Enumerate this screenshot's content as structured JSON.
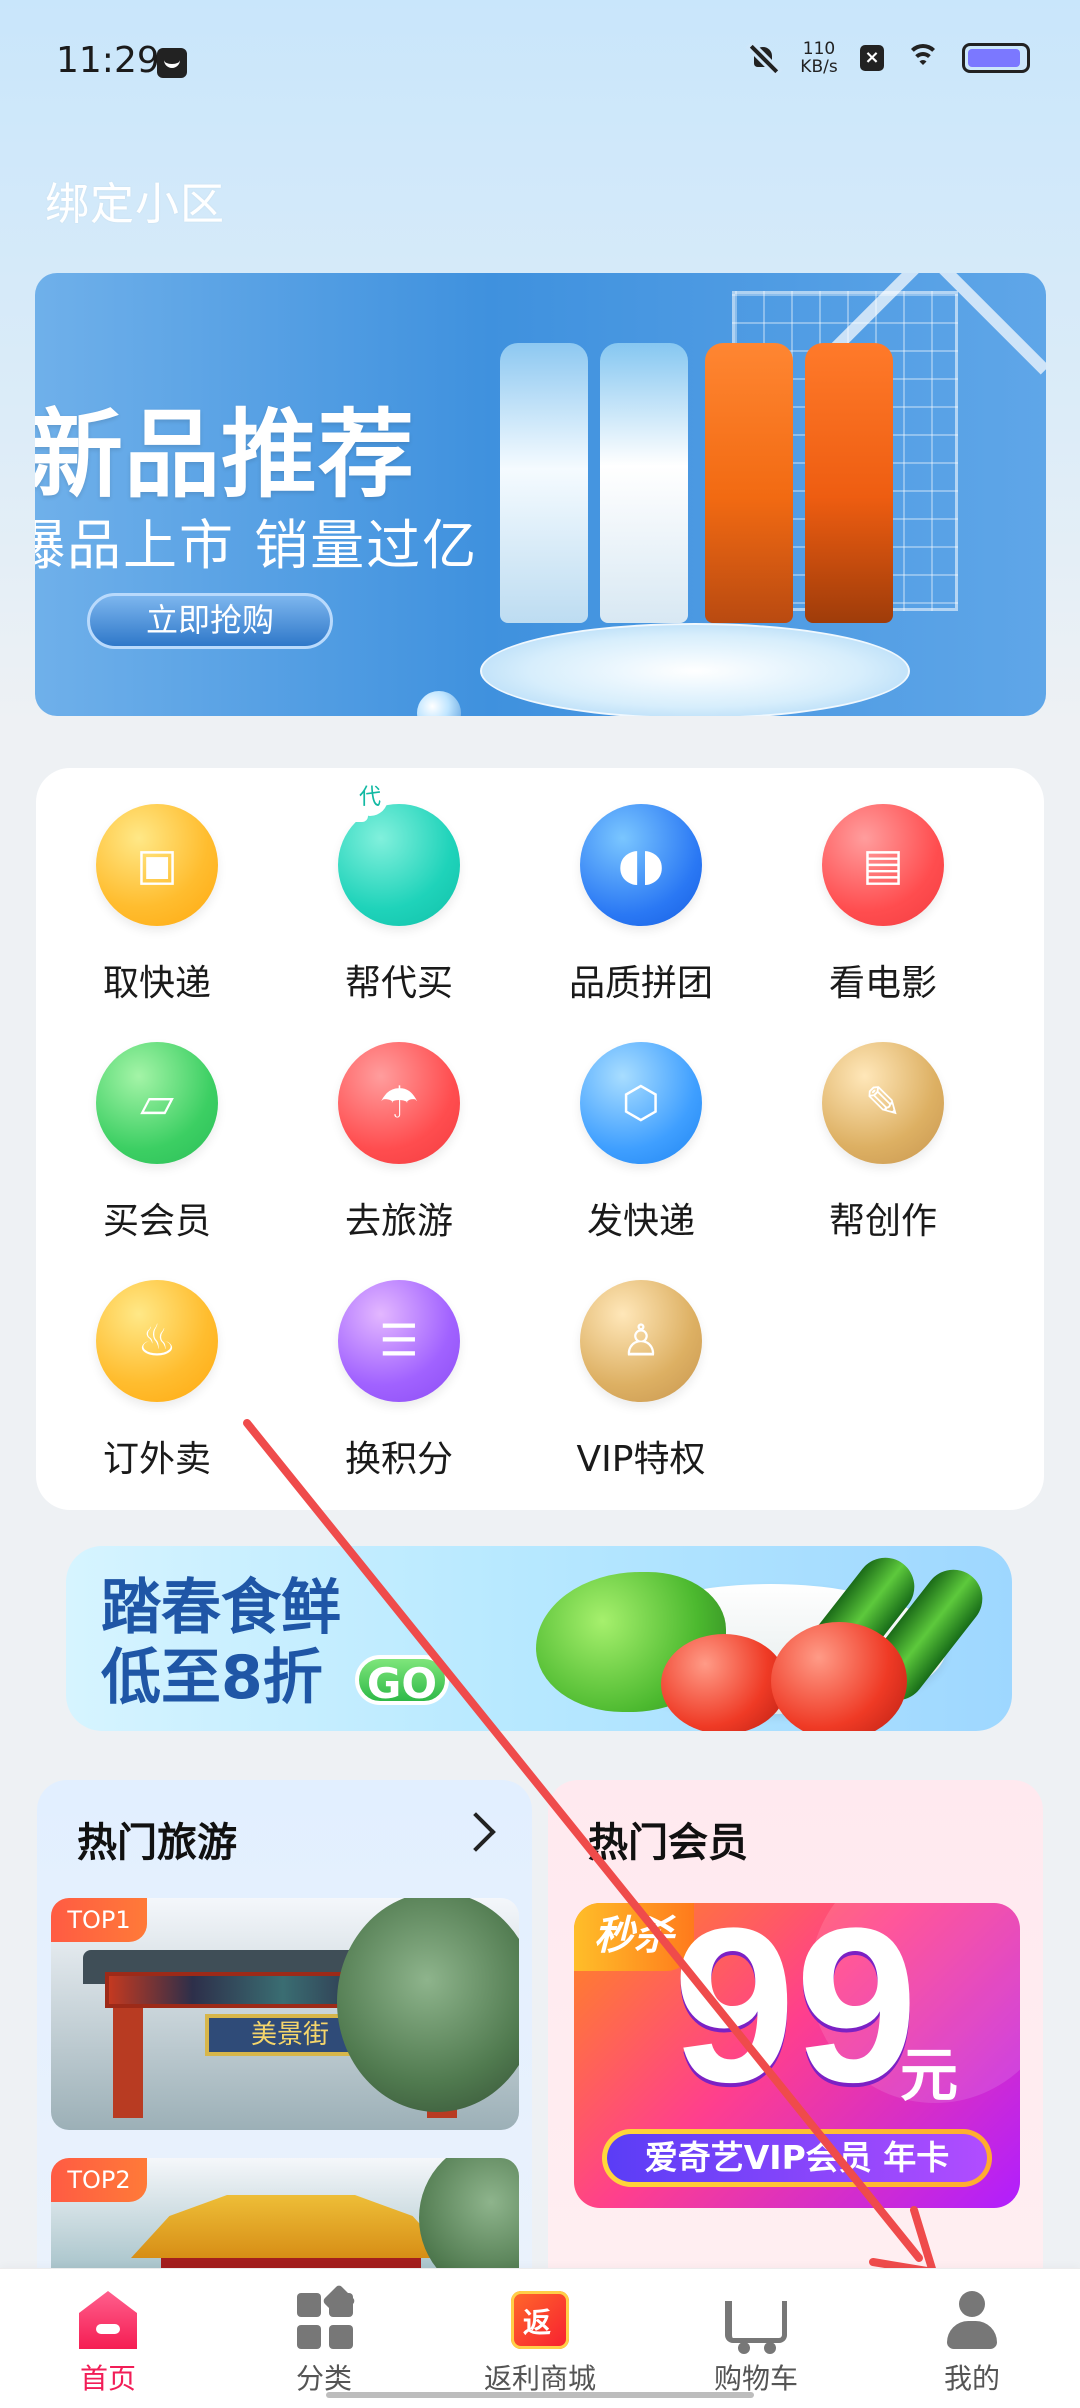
{
  "status": {
    "time": "11:29",
    "speed_top": "110",
    "speed_bottom": "KB/s"
  },
  "header": {
    "community": "绑定小区"
  },
  "banner": {
    "title": "新品推荐",
    "subtitle": "爆品上市 销量过亿",
    "button": "立即抢购"
  },
  "services": [
    {
      "label": "取快递",
      "icon": "package-delivery-icon"
    },
    {
      "label": "帮代买",
      "icon": "car-proxy-buy-icon"
    },
    {
      "label": "品质拼团",
      "icon": "capsule-icon"
    },
    {
      "label": "看电影",
      "icon": "ticket-icon"
    },
    {
      "label": "买会员",
      "icon": "tv-vip-icon"
    },
    {
      "label": "去旅游",
      "icon": "palm-tree-icon"
    },
    {
      "label": "发快递",
      "icon": "box-icon"
    },
    {
      "label": "帮创作",
      "icon": "pencil-icon"
    },
    {
      "label": "订外卖",
      "icon": "scooter-icon"
    },
    {
      "label": "换积分",
      "icon": "coins-icon"
    },
    {
      "label": "VIP特权",
      "icon": "vip-user-icon"
    }
  ],
  "fresh": {
    "line1": "踏春食鲜",
    "line2": "低至8折",
    "go": "GO"
  },
  "hot_travel": {
    "title": "热门旅游",
    "card1_badge": "TOP1",
    "card2_badge": "TOP2",
    "gate_sign": "美景街"
  },
  "hot_vip": {
    "title": "热门会员",
    "flash": "秒杀",
    "price": "99",
    "unit": "元",
    "product": "爱奇艺VIP会员 年卡"
  },
  "bottom_nav": [
    {
      "label": "首页",
      "icon": "home-icon"
    },
    {
      "label": "分类",
      "icon": "category-icon"
    },
    {
      "label": "返利商城",
      "icon": "rebate-mall-icon"
    },
    {
      "label": "购物车",
      "icon": "cart-icon"
    },
    {
      "label": "我的",
      "icon": "user-icon"
    }
  ],
  "colors": {
    "accent": "#f21d57",
    "header_bg": "#c9e6fb",
    "page_bg": "#eef1f4",
    "annotation_arrow": "#ef4b4b"
  }
}
